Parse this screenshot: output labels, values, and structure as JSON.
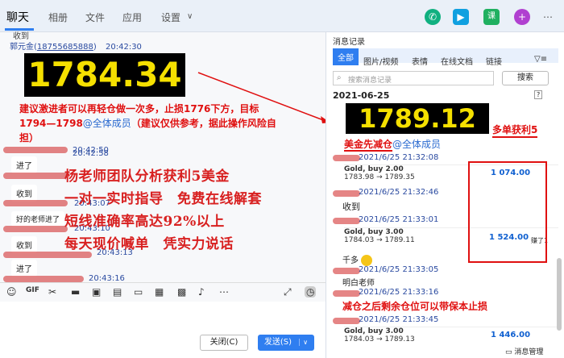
{
  "nav": {
    "tabs": [
      "聊天",
      "相册",
      "文件",
      "应用",
      "设置"
    ],
    "settings_caret": "∨"
  },
  "chat": {
    "top_cut": "收到",
    "sender": "郭元金(",
    "sender_phone": "18755685888",
    "sender_close": ")",
    "sender_time": "20:42:30",
    "price1": "1784.34",
    "advice": "建议激进者可以再轻仓做一次多，止损1776下方，目标1794—1798",
    "mention": "@全体成员",
    "advice_tail": "（建议仅供参考，据此操作风险自担）",
    "t1": "20:42:50",
    "m1": "进了",
    "t2": "20:42:58",
    "m2": "收到",
    "t3": "20:43:07",
    "m3": "好的老师进了",
    "t4": "20:43:10",
    "m4": "收到",
    "t5": "20:43:13",
    "m5": "进了",
    "t6": "20:43:16",
    "overlay": [
      "杨老师团队分析获利5美金",
      "一对一实时指导　免费在线解套",
      "短线准确率高达92%以上",
      "每天现价喊单　凭实力说话"
    ],
    "close_btn": "关闭(C)",
    "send_btn": "发送(S)",
    "send_caret": "∨"
  },
  "history": {
    "title": "消息记录",
    "tabs": [
      "全部",
      "图片/视频",
      "表情",
      "在线文档",
      "链接"
    ],
    "search_placeholder": "搜索消息记录",
    "search_btn": "搜索",
    "date": "2021-06-25",
    "price2": "1789.12",
    "more_profit": "多单获利5",
    "reduce": "美金先减仓",
    "reduce_mention": "@全体成员",
    "r1": "2021/6/25 21:32:08",
    "card1_line1": "Gold, buy 2.00",
    "card1_line2": "1783.98 → 1789.35",
    "card1_profit": "1 074.00",
    "r2": "2021/6/25 21:32:46",
    "rm2": "收到",
    "r3": "2021/6/25 21:33:01",
    "card2_line1": "Gold, buy 3.00",
    "card2_line2": "1784.03 → 1789.11",
    "card2_profit": "1 524.00",
    "card2_note": "赚了1",
    "rm3": "千多",
    "r4": "2021/6/25 21:33:05",
    "rm4": "明白老师",
    "r5": "2021/6/25 21:33:16",
    "red_note": "减仓之后剩余仓位可以带保本止损",
    "r6": "2021/6/25 21:33:45",
    "card3_line1": "Gold, buy 3.00",
    "card3_line2": "1784.03 → 1789.13",
    "card3_profit": "1 446.00",
    "manage": "消息管理"
  }
}
